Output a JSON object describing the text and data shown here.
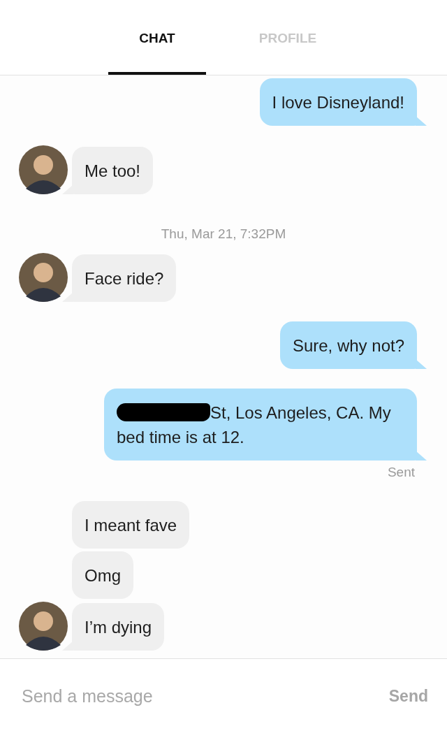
{
  "tabs": [
    {
      "label": "CHAT",
      "selected": true
    },
    {
      "label": "PROFILE",
      "selected": false
    }
  ],
  "messages": [
    {
      "kind": "outgoing",
      "text": "I love Disneyland!"
    },
    {
      "kind": "incoming",
      "text": "Me too!",
      "avatar": true
    },
    {
      "kind": "timestamp",
      "text": "Thu, Mar 21, 7:32PM"
    },
    {
      "kind": "incoming",
      "text": "Face ride?",
      "avatar": true
    },
    {
      "kind": "outgoing",
      "text": "Sure, why not?"
    },
    {
      "kind": "outgoing",
      "text": "St, Los Angeles, CA. My bed time is at 12.",
      "redacted": true
    },
    {
      "kind": "status",
      "text": "Sent"
    },
    {
      "kind": "incoming",
      "text": "I meant fave",
      "avatar": false
    },
    {
      "kind": "incoming",
      "text": "Omg",
      "avatar": false
    },
    {
      "kind": "incoming",
      "text": "I’m dying",
      "avatar": true
    }
  ],
  "composer": {
    "placeholder": "Send a message",
    "button": "Send"
  }
}
